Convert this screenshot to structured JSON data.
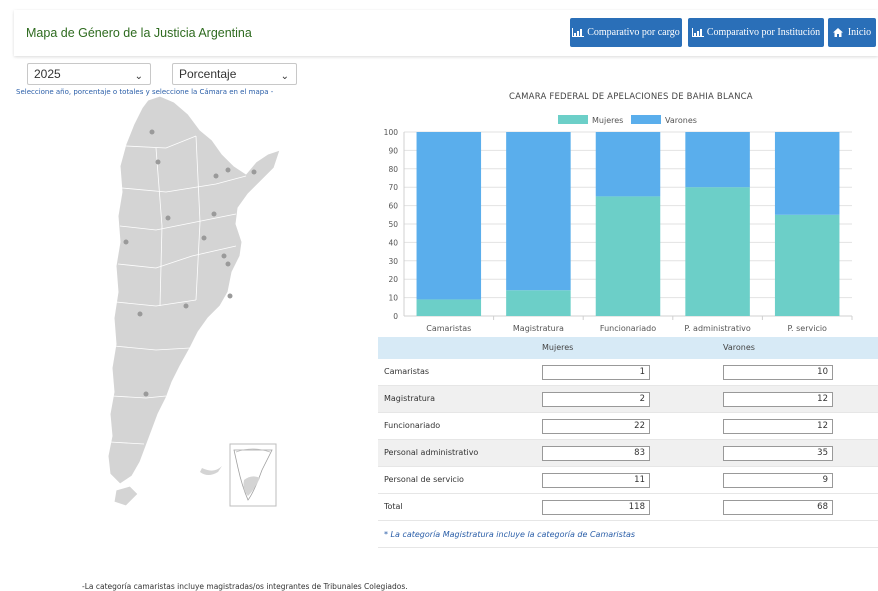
{
  "header": {
    "title": "Mapa de Género de la Justicia Argentina",
    "buttons": [
      {
        "label": "Comparativo por cargo",
        "icon": "chart-icon"
      },
      {
        "label": "Comparativo por Institución",
        "icon": "chart-icon"
      },
      {
        "label": "Inicio",
        "icon": "home-icon"
      }
    ]
  },
  "filters": {
    "year": "2025",
    "mode": "Porcentaje",
    "hint": "Seleccione año, porcentaje o totales y seleccione la Cámara en el mapa -"
  },
  "chart_data": {
    "type": "bar",
    "stacked": true,
    "title": "CAMARA FEDERAL DE APELACIONES DE BAHIA BLANCA",
    "categories": [
      "Camaristas",
      "Magistratura",
      "Funcionariado",
      "P. administrativo",
      "P. servicio"
    ],
    "series": [
      {
        "name": "Mujeres",
        "color": "#6ccfc8",
        "values": [
          9,
          14,
          65,
          70,
          55
        ]
      },
      {
        "name": "Varones",
        "color": "#5aaeec",
        "values": [
          91,
          86,
          35,
          30,
          45
        ]
      }
    ],
    "ylim": [
      0,
      100
    ],
    "yticks": [
      0,
      10,
      20,
      30,
      40,
      50,
      60,
      70,
      80,
      90,
      100
    ],
    "legend": "top-center",
    "grid": true
  },
  "table": {
    "headers": [
      "Mujeres",
      "Varones"
    ],
    "rows": [
      {
        "label": "Camaristas",
        "mujeres": "1",
        "varones": "10"
      },
      {
        "label": "Magistratura",
        "mujeres": "2",
        "varones": "12"
      },
      {
        "label": "Funcionariado",
        "mujeres": "22",
        "varones": "12"
      },
      {
        "label": "Personal administrativo",
        "mujeres": "83",
        "varones": "35"
      },
      {
        "label": "Personal de servicio",
        "mujeres": "11",
        "varones": "9"
      },
      {
        "label": "Total",
        "mujeres": "118",
        "varones": "68"
      }
    ],
    "note": "* La categoría Magistratura incluye la categoría de Camaristas"
  },
  "footer": "-La categoría camaristas incluye magistradas/os integrantes de Tribunales Colegiados."
}
